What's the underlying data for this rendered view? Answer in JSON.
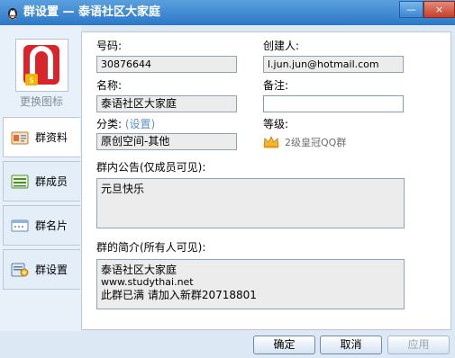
{
  "window": {
    "title": "群设置 — 泰语社区大家庭",
    "min_label": "—",
    "close_label": "×"
  },
  "sidebar": {
    "change_icon_label": "更换图标",
    "items": [
      {
        "label": "群资料",
        "icon": "group-info-icon",
        "active": true
      },
      {
        "label": "群成员",
        "icon": "members-icon",
        "active": false
      },
      {
        "label": "群名片",
        "icon": "card-icon",
        "active": false
      },
      {
        "label": "群设置",
        "icon": "settings-icon",
        "active": false
      }
    ]
  },
  "form": {
    "id_label": "号码:",
    "id_value": "30876644",
    "creator_label": "创建人:",
    "creator_value": "l.jun.jun@hotmail.com",
    "name_label": "名称:",
    "name_value": "泰语社区大家庭",
    "remark_label": "备注:",
    "remark_value": "",
    "category_label": "分类:",
    "category_link": "(设置)",
    "category_value": "原创空间-其他",
    "level_label": "等级:",
    "level_value": "2级皇冠QQ群",
    "notice_label": "群内公告(仅成员可见):",
    "notice_lines": [
      "元旦快乐"
    ],
    "intro_label": "群的简介(所有人可见):",
    "intro_lines": [
      "泰语社区大家庭",
      "www.studythai.net",
      "此群已满 请加入新群20718801"
    ]
  },
  "buttons": {
    "ok": "确定",
    "cancel": "取消",
    "apply": "应用"
  },
  "colors": {
    "titlebar": "#2c78c6",
    "window_bg": "#dce9f5",
    "link": "#5b8fc6"
  }
}
